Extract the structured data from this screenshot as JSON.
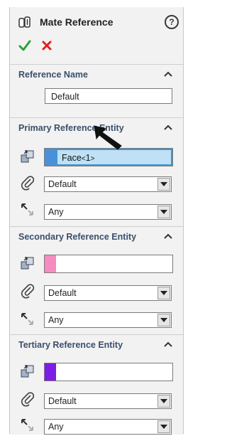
{
  "panel": {
    "title": "Mate Reference",
    "help_symbol": "?"
  },
  "sections": {
    "reference_name": {
      "title": "Reference Name",
      "name_value": "Default"
    },
    "primary": {
      "title": "Primary Reference Entity",
      "entity_color": "#4a90d9",
      "entity_name": "Face",
      "entity_index_open": "<",
      "entity_index": "1",
      "entity_index_close": ">",
      "mate_type": "Default",
      "alignment": "Any"
    },
    "secondary": {
      "title": "Secondary Reference Entity",
      "entity_color": "#f48cc0",
      "mate_type": "Default",
      "alignment": "Any"
    },
    "tertiary": {
      "title": "Tertiary Reference Entity",
      "entity_color": "#7d1ce6",
      "mate_type": "Default",
      "alignment": "Any"
    }
  },
  "icons": {
    "title": "mate-reference-icon",
    "help": "help-icon",
    "ok": "checkmark-icon",
    "cancel": "x-icon",
    "entity": "reference-entity-icon",
    "mate_type": "paperclip-icon",
    "alignment": "alignment-arrow-icon",
    "collapse": "chevron-up-icon"
  },
  "colors": {
    "ok": "#2aa336",
    "cancel": "#e02020",
    "section_title": "#3b4f6b",
    "selected_highlight": "#bfe0f5"
  }
}
